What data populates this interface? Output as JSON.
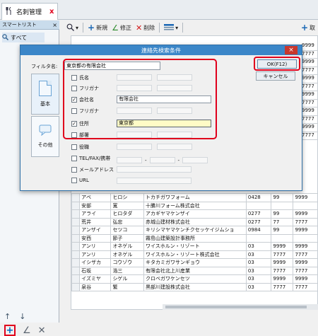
{
  "tab": {
    "label": "名刺管理",
    "close": "x"
  },
  "smart_list": {
    "header": "スマートリスト",
    "close": "×",
    "items": [
      {
        "label": "すべて"
      }
    ]
  },
  "toolbar": {
    "new": "新規",
    "edit": "修正",
    "delete": "削除",
    "import": "取"
  },
  "dialog": {
    "title": "連絡先検索条件",
    "close": "×",
    "filter_label": "フィルタ名:",
    "filter_value": "東京都の有限会社",
    "ok": "OK(F12)",
    "cancel": "キャンセル",
    "side_tabs": [
      "基本",
      "その他"
    ],
    "criteria": [
      {
        "label": "氏名",
        "checked": false,
        "value": ""
      },
      {
        "label": "フリガナ",
        "checked": false,
        "value": ""
      },
      {
        "label": "会社名",
        "checked": true,
        "value": "有限会社"
      },
      {
        "label": "フリガナ",
        "checked": false,
        "value": ""
      },
      {
        "label": "住所",
        "checked": true,
        "value": "東京都"
      },
      {
        "label": "部署",
        "checked": false,
        "value": ""
      },
      {
        "label": "役職",
        "checked": false,
        "value": ""
      },
      {
        "label": "TEL/FAX/携帯",
        "checked": false,
        "value": ""
      },
      {
        "label": "メールアドレス",
        "checked": false,
        "value": ""
      },
      {
        "label": "URL",
        "checked": false,
        "value": ""
      }
    ],
    "tel_dash": "-"
  },
  "table": {
    "rows": [
      [
        "アベ",
        "ヒロシ",
        "トカチガワフォーム",
        "0428",
        "99",
        "9999"
      ],
      [
        "安部",
        "寛",
        "十勝川フォーム株式会社",
        "",
        "",
        ""
      ],
      [
        "アライ",
        "ヒロタダ",
        "アカギヤマケンザイ",
        "0277",
        "99",
        "9999"
      ],
      [
        "荒井",
        "弘忠",
        "赤城山建材株式会社",
        "0277",
        "77",
        "7777"
      ],
      [
        "アンザイ",
        "セツコ",
        "キリシマヤマケンチクセッケイジムショ",
        "0984",
        "99",
        "9999"
      ],
      [
        "安西",
        "節子",
        "霧島山建築設計事務所",
        "",
        "",
        ""
      ],
      [
        "アンリ",
        "オネゲル",
        "ワイスホルン・リゾート",
        "03",
        "9999",
        "9999"
      ],
      [
        "アンリ",
        "オネゲル",
        "ワイスホルン・リゾート株式会社",
        "03",
        "7777",
        "7777"
      ],
      [
        "イシザカ",
        "コウゾウ",
        "キタカミガワサンギョウ",
        "03",
        "9999",
        "9999"
      ],
      [
        "石坂",
        "浩三",
        "有限会社北上川産業",
        "03",
        "7777",
        "7777"
      ],
      [
        "イズミヤ",
        "シゲル",
        "クロベガワケンセツ",
        "03",
        "9999",
        "9999"
      ],
      [
        "泉谷",
        "繁",
        "黒部川建設株式会社",
        "03",
        "7777",
        "7777"
      ]
    ],
    "right_col": [
      "9999",
      "7777",
      "9999",
      "7777",
      "9999",
      "7777",
      "9999",
      "7777",
      "9999",
      "7777",
      "9999",
      "7777"
    ]
  }
}
